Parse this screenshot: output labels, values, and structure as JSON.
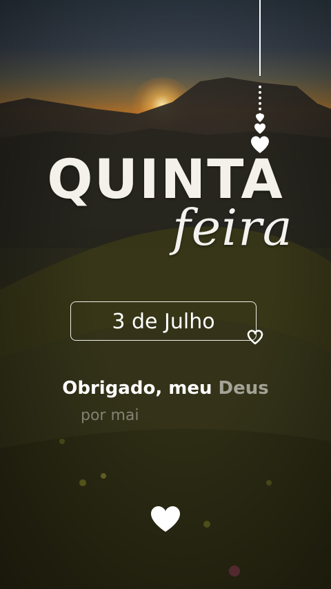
{
  "card": {
    "day_title": "QUINTA",
    "day_subtitle": "feira",
    "date": "3 de Julho",
    "message_main": "Obrigado, meu",
    "message_fade": "Deus",
    "message_sub": "por mai"
  },
  "colors": {
    "text": "#ffffff",
    "sunset": "#e08a2a",
    "meadow": "#4a4a1a"
  },
  "icons": {
    "ornament": "hanging-hearts-icon",
    "small": "heart-outline-icon",
    "bottom": "heart-icon"
  }
}
